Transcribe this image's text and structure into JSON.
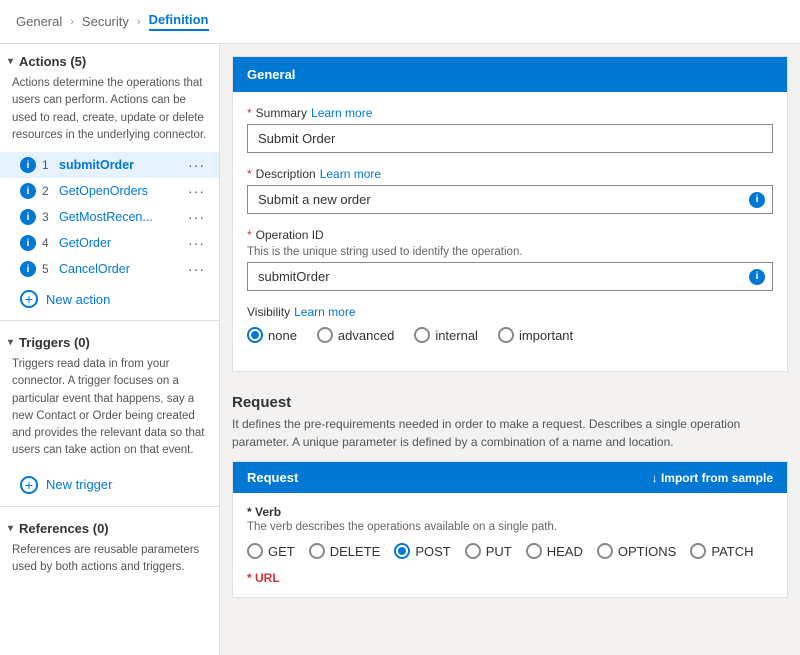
{
  "breadcrumb": {
    "items": [
      {
        "label": "General",
        "active": false
      },
      {
        "label": "Security",
        "active": false
      },
      {
        "label": "Definition",
        "active": true
      }
    ]
  },
  "sidebar": {
    "actions": {
      "header": "Actions (5)",
      "description": "Actions determine the operations that users can perform. Actions can be used to read, create, update or delete resources in the underlying connector.",
      "items": [
        {
          "num": "1",
          "name": "submitOrder",
          "bold": true,
          "selected": true
        },
        {
          "num": "2",
          "name": "GetOpenOrders",
          "bold": false,
          "selected": false
        },
        {
          "num": "3",
          "name": "GetMostRecen...",
          "bold": false,
          "selected": false
        },
        {
          "num": "4",
          "name": "GetOrder",
          "bold": false,
          "selected": false
        },
        {
          "num": "5",
          "name": "CancelOrder",
          "bold": false,
          "selected": false
        }
      ],
      "new_action_label": "New action"
    },
    "triggers": {
      "header": "Triggers (0)",
      "description": "Triggers read data in from your connector. A trigger focuses on a particular event that happens, say a new Contact or Order being created and provides the relevant data so that users can take action on that event.",
      "new_trigger_label": "New trigger"
    },
    "references": {
      "header": "References (0)",
      "description": "References are reusable parameters used by both actions and triggers."
    }
  },
  "general_card": {
    "title": "General",
    "summary": {
      "label": "Summary",
      "learn_more": "Learn more",
      "value": "Submit Order"
    },
    "description": {
      "label": "Description",
      "learn_more": "Learn more",
      "value": "Submit a new order"
    },
    "operation_id": {
      "label": "Operation ID",
      "desc": "This is the unique string used to identify the operation.",
      "value": "submitOrder"
    },
    "visibility": {
      "label": "Visibility",
      "learn_more": "Learn more",
      "options": [
        {
          "value": "none",
          "selected": true
        },
        {
          "value": "advanced",
          "selected": false
        },
        {
          "value": "internal",
          "selected": false
        },
        {
          "value": "important",
          "selected": false
        }
      ]
    }
  },
  "request_section": {
    "title": "Request",
    "description": "It defines the pre-requirements needed in order to make a request. Describes a single operation parameter. A unique parameter is defined by a combination of a name and location.",
    "card": {
      "header": "Request",
      "import_label": "↓ Import from sample"
    },
    "verb": {
      "label": "* Verb",
      "desc": "The verb describes the operations available on a single path.",
      "options": [
        {
          "value": "GET",
          "selected": false
        },
        {
          "value": "DELETE",
          "selected": false
        },
        {
          "value": "POST",
          "selected": true
        },
        {
          "value": "PUT",
          "selected": false
        },
        {
          "value": "HEAD",
          "selected": false
        },
        {
          "value": "OPTIONS",
          "selected": false
        },
        {
          "value": "PATCH",
          "selected": false
        }
      ]
    },
    "url_label": "* URL"
  }
}
